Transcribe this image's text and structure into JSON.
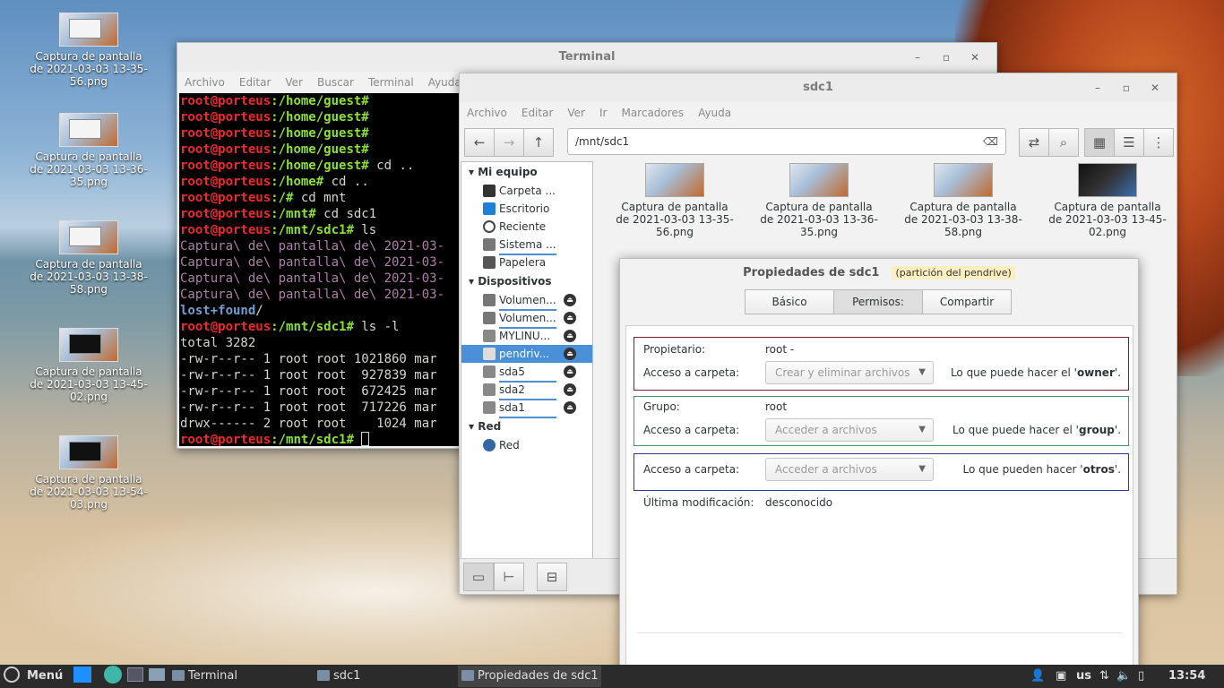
{
  "desktop": {
    "icons": [
      {
        "label_1": "Captura de pantalla",
        "label_2": "de 2021-03-03 13-35-",
        "label_3": "56.png"
      },
      {
        "label_1": "Captura de pantalla",
        "label_2": "de 2021-03-03 13-36-",
        "label_3": "35.png"
      },
      {
        "label_1": "Captura de pantalla",
        "label_2": "de 2021-03-03 13-38-",
        "label_3": "58.png"
      },
      {
        "label_1": "Captura de pantalla",
        "label_2": "de 2021-03-03 13-45-",
        "label_3": "02.png"
      },
      {
        "label_1": "Captura de pantalla",
        "label_2": "de 2021-03-03 13-54-",
        "label_3": "03.png"
      }
    ]
  },
  "terminal": {
    "title": "Terminal",
    "menu": [
      "Archivo",
      "Editar",
      "Ver",
      "Buscar",
      "Terminal",
      "Ayuda"
    ],
    "lines": {
      "p_root": "root@porteus",
      "home_guest": ":/home/guest#",
      "home": ":/home#",
      "root_dir": ":/#",
      "mnt": ":/mnt#",
      "mnt_sdc1": ":/mnt/sdc1#",
      "cmd_cd_up": " cd ..",
      "cmd_cd_mnt": " cd mnt",
      "cmd_cd_sdc1": " cd sdc1",
      "cmd_ls": " ls",
      "cmd_ls_l": " ls -l",
      "cap": "Captura\\ de\\ pantalla\\ de\\ 2021-03-",
      "lost": "lost+found",
      "slash": "/",
      "total": "total 3282",
      "r1": "-rw-r--r-- 1 root root 1021860 mar",
      "r2": "-rw-r--r-- 1 root root  927839 mar",
      "r3": "-rw-r--r-- 1 root root  672425 mar",
      "r4": "-rw-r--r-- 1 root root  717226 mar",
      "r5": "drwx------ 2 root root    1024 mar"
    }
  },
  "filemanager": {
    "title": "sdc1",
    "menu": [
      "Archivo",
      "Editar",
      "Ver",
      "Ir",
      "Marcadores",
      "Ayuda"
    ],
    "path": "/mnt/sdc1",
    "sidebar": {
      "sec_equipo": "Mi equipo",
      "equipo": [
        "Carpeta ...",
        "Escritorio",
        "Reciente",
        "Sistema ...",
        "Papelera"
      ],
      "sec_disp": "Dispositivos",
      "disp": [
        "Volumen...",
        "Volumen...",
        "MYLINU...",
        "pendriv...",
        "sda5",
        "sda2",
        "sda1"
      ],
      "sec_red": "Red",
      "red": [
        "Red"
      ]
    },
    "files": [
      {
        "l1": "Captura de pantalla",
        "l2": "de 2021-03-03 13-35-",
        "l3": "56.png"
      },
      {
        "l1": "Captura de pantalla",
        "l2": "de 2021-03-03 13-36-",
        "l3": "35.png"
      },
      {
        "l1": "Captura de pantalla",
        "l2": "de 2021-03-03 13-38-",
        "l3": "58.png"
      },
      {
        "l1": "Captura de pantalla",
        "l2": "de 2021-03-03 13-45-",
        "l3": "02.png"
      }
    ]
  },
  "dialog": {
    "title": "Propiedades de sdc1",
    "annotation": "(partición del pendrive)",
    "tabs": [
      "Básico",
      "Permisos:",
      "Compartir"
    ],
    "owner_label": "Propietario:",
    "owner_value": "root -",
    "access_label": "Acceso a carpeta:",
    "owner_access": "Crear y eliminar archivos",
    "owner_note_pre": "Lo que puede hacer el '",
    "owner_note_key": "owner",
    "note_post": "'.",
    "group_label": "Grupo:",
    "group_value": "root",
    "group_access": "Acceder a archivos",
    "group_note_pre": "Lo que puede hacer el '",
    "group_note_key": "group",
    "others_access": "Acceder a archivos",
    "others_note_pre": "Lo que pueden hacer '",
    "others_note_key": "otros",
    "modified_label": "Última modificación:",
    "modified_value": "desconocido"
  },
  "taskbar": {
    "menu": "Menú",
    "tasks": [
      "Terminal",
      "sdc1",
      "Propiedades de sdc1"
    ],
    "layout": "us",
    "clock": "13:54"
  },
  "colors": {
    "owner_frame": "#7a1f2b",
    "group_frame": "#3c9a5f",
    "others_frame": "#2d3a9a",
    "selection": "#4a90d9"
  }
}
